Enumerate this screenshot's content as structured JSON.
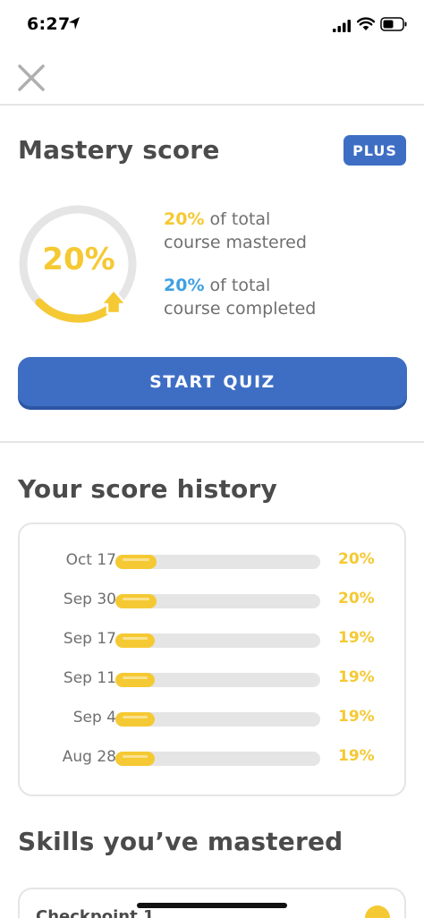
{
  "status_bar": {
    "time": "6:27"
  },
  "header": {
    "close_icon": "close-icon"
  },
  "mastery": {
    "title": "Mastery score",
    "badge": "PLUS",
    "ring_value": "20%",
    "mastered_pct": "20%",
    "mastered_text_1": "of total",
    "mastered_text_2": "course mastered",
    "completed_pct": "20%",
    "completed_text_1": "of total",
    "completed_text_2": "course completed",
    "start_quiz": "START QUIZ"
  },
  "history": {
    "title": "Your score history",
    "rows": [
      {
        "date": "Oct 17",
        "value": 20,
        "label": "20%"
      },
      {
        "date": "Sep 30",
        "value": 20,
        "label": "20%"
      },
      {
        "date": "Sep 17",
        "value": 19,
        "label": "19%"
      },
      {
        "date": "Sep 11",
        "value": 19,
        "label": "19%"
      },
      {
        "date": "Sep 4",
        "value": 19,
        "label": "19%"
      },
      {
        "date": "Aug 28",
        "value": 19,
        "label": "19%"
      }
    ]
  },
  "skills": {
    "title": "Skills you’ve mastered",
    "items": [
      {
        "name": "Checkpoint 1"
      }
    ]
  },
  "colors": {
    "accent_blue": "#3e6ec4",
    "gold": "#f5c933",
    "light_blue": "#3fa0e2",
    "track_gray": "#e5e5e5"
  }
}
